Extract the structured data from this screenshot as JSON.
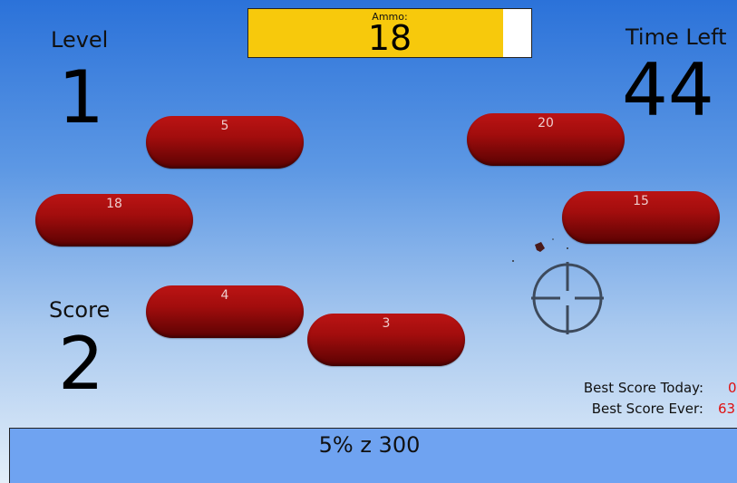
{
  "ammo": {
    "label": "Ammo:",
    "value": "18",
    "fill_fraction": 0.9
  },
  "level": {
    "label": "Level",
    "value": "1"
  },
  "time": {
    "label": "Time Left",
    "value": "44"
  },
  "score": {
    "label": "Score",
    "value": "2"
  },
  "targets": [
    {
      "label": "5"
    },
    {
      "label": "20"
    },
    {
      "label": "18"
    },
    {
      "label": "15"
    },
    {
      "label": "4"
    },
    {
      "label": "3"
    }
  ],
  "best_scores": {
    "today_label": "Best Score Today:",
    "today_value": "0",
    "ever_label": "Best Score Ever:",
    "ever_value": "63"
  },
  "status": {
    "text": "5% z 300"
  },
  "icons": {
    "crosshair": "crosshair-icon",
    "bullet_hole": "bullet-hole-icon"
  },
  "colors": {
    "ammo_fill": "#f7c90c",
    "target": "#a20d0d",
    "best_score_value": "#e01010",
    "status_bar": "#6fa3f1",
    "crosshair": "#3d4a5c"
  }
}
